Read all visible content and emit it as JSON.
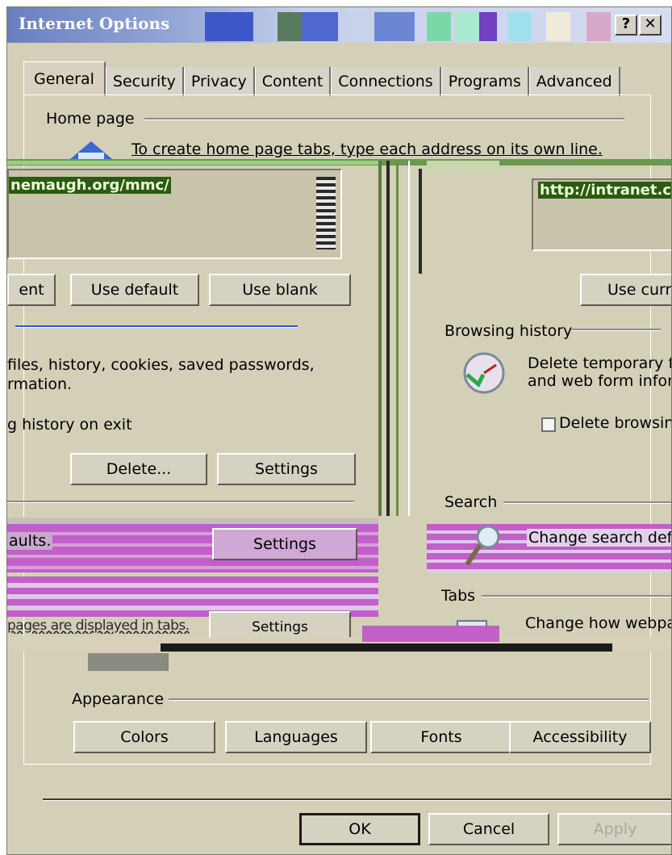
{
  "window": {
    "title": "Internet Options",
    "help_glyph": "?",
    "close_glyph": "✕"
  },
  "tabs": [
    "General",
    "Security",
    "Privacy",
    "Content",
    "Connections",
    "Programs",
    "Advanced"
  ],
  "home_page": {
    "title": "Home page",
    "instruction": "To create home page tabs, type each address on its own line.",
    "url_left": "nemaugh.org/mmc/",
    "url_right": "http://intranet.co",
    "buttons": [
      "ent",
      "Use default",
      "Use blank"
    ],
    "use_current_label": "Use curre"
  },
  "browsing_history": {
    "title": "Browsing history",
    "left_text": [
      "files, history, cookies, saved passwords,",
      "rmation."
    ],
    "right_text": [
      "Delete temporary f",
      "and web form infor"
    ],
    "exit_left": "g history on exit",
    "exit_right": "Delete browsin",
    "delete_button": "Delete...",
    "settings_button": "Settings"
  },
  "search": {
    "title": "Search",
    "left_text": "aults.",
    "right_text": "Change search def",
    "settings_button": "Settings"
  },
  "tabs_group": {
    "title": "Tabs",
    "left_text": "pages are displayed in tabs.",
    "right_text": "Change how webpa",
    "settings_button": "Settings"
  },
  "appearance": {
    "title": "Appearance",
    "buttons": [
      "Colors",
      "Languages",
      "Fonts",
      "Accessibility"
    ]
  },
  "footer": {
    "ok": "OK",
    "cancel": "Cancel",
    "apply": "Apply"
  },
  "colors": {
    "dialog_bg": "#d4d0b8",
    "selection_bg": "#2c5a10",
    "selection_fg": "#e8ffd8",
    "glitch_magenta": "#c060c8",
    "titlebar_blue": "#6a7fc0"
  },
  "icons": [
    "house-icon",
    "history-icon",
    "search-magnifier-icon",
    "tabs-icon",
    "help-icon",
    "close-icon"
  ]
}
